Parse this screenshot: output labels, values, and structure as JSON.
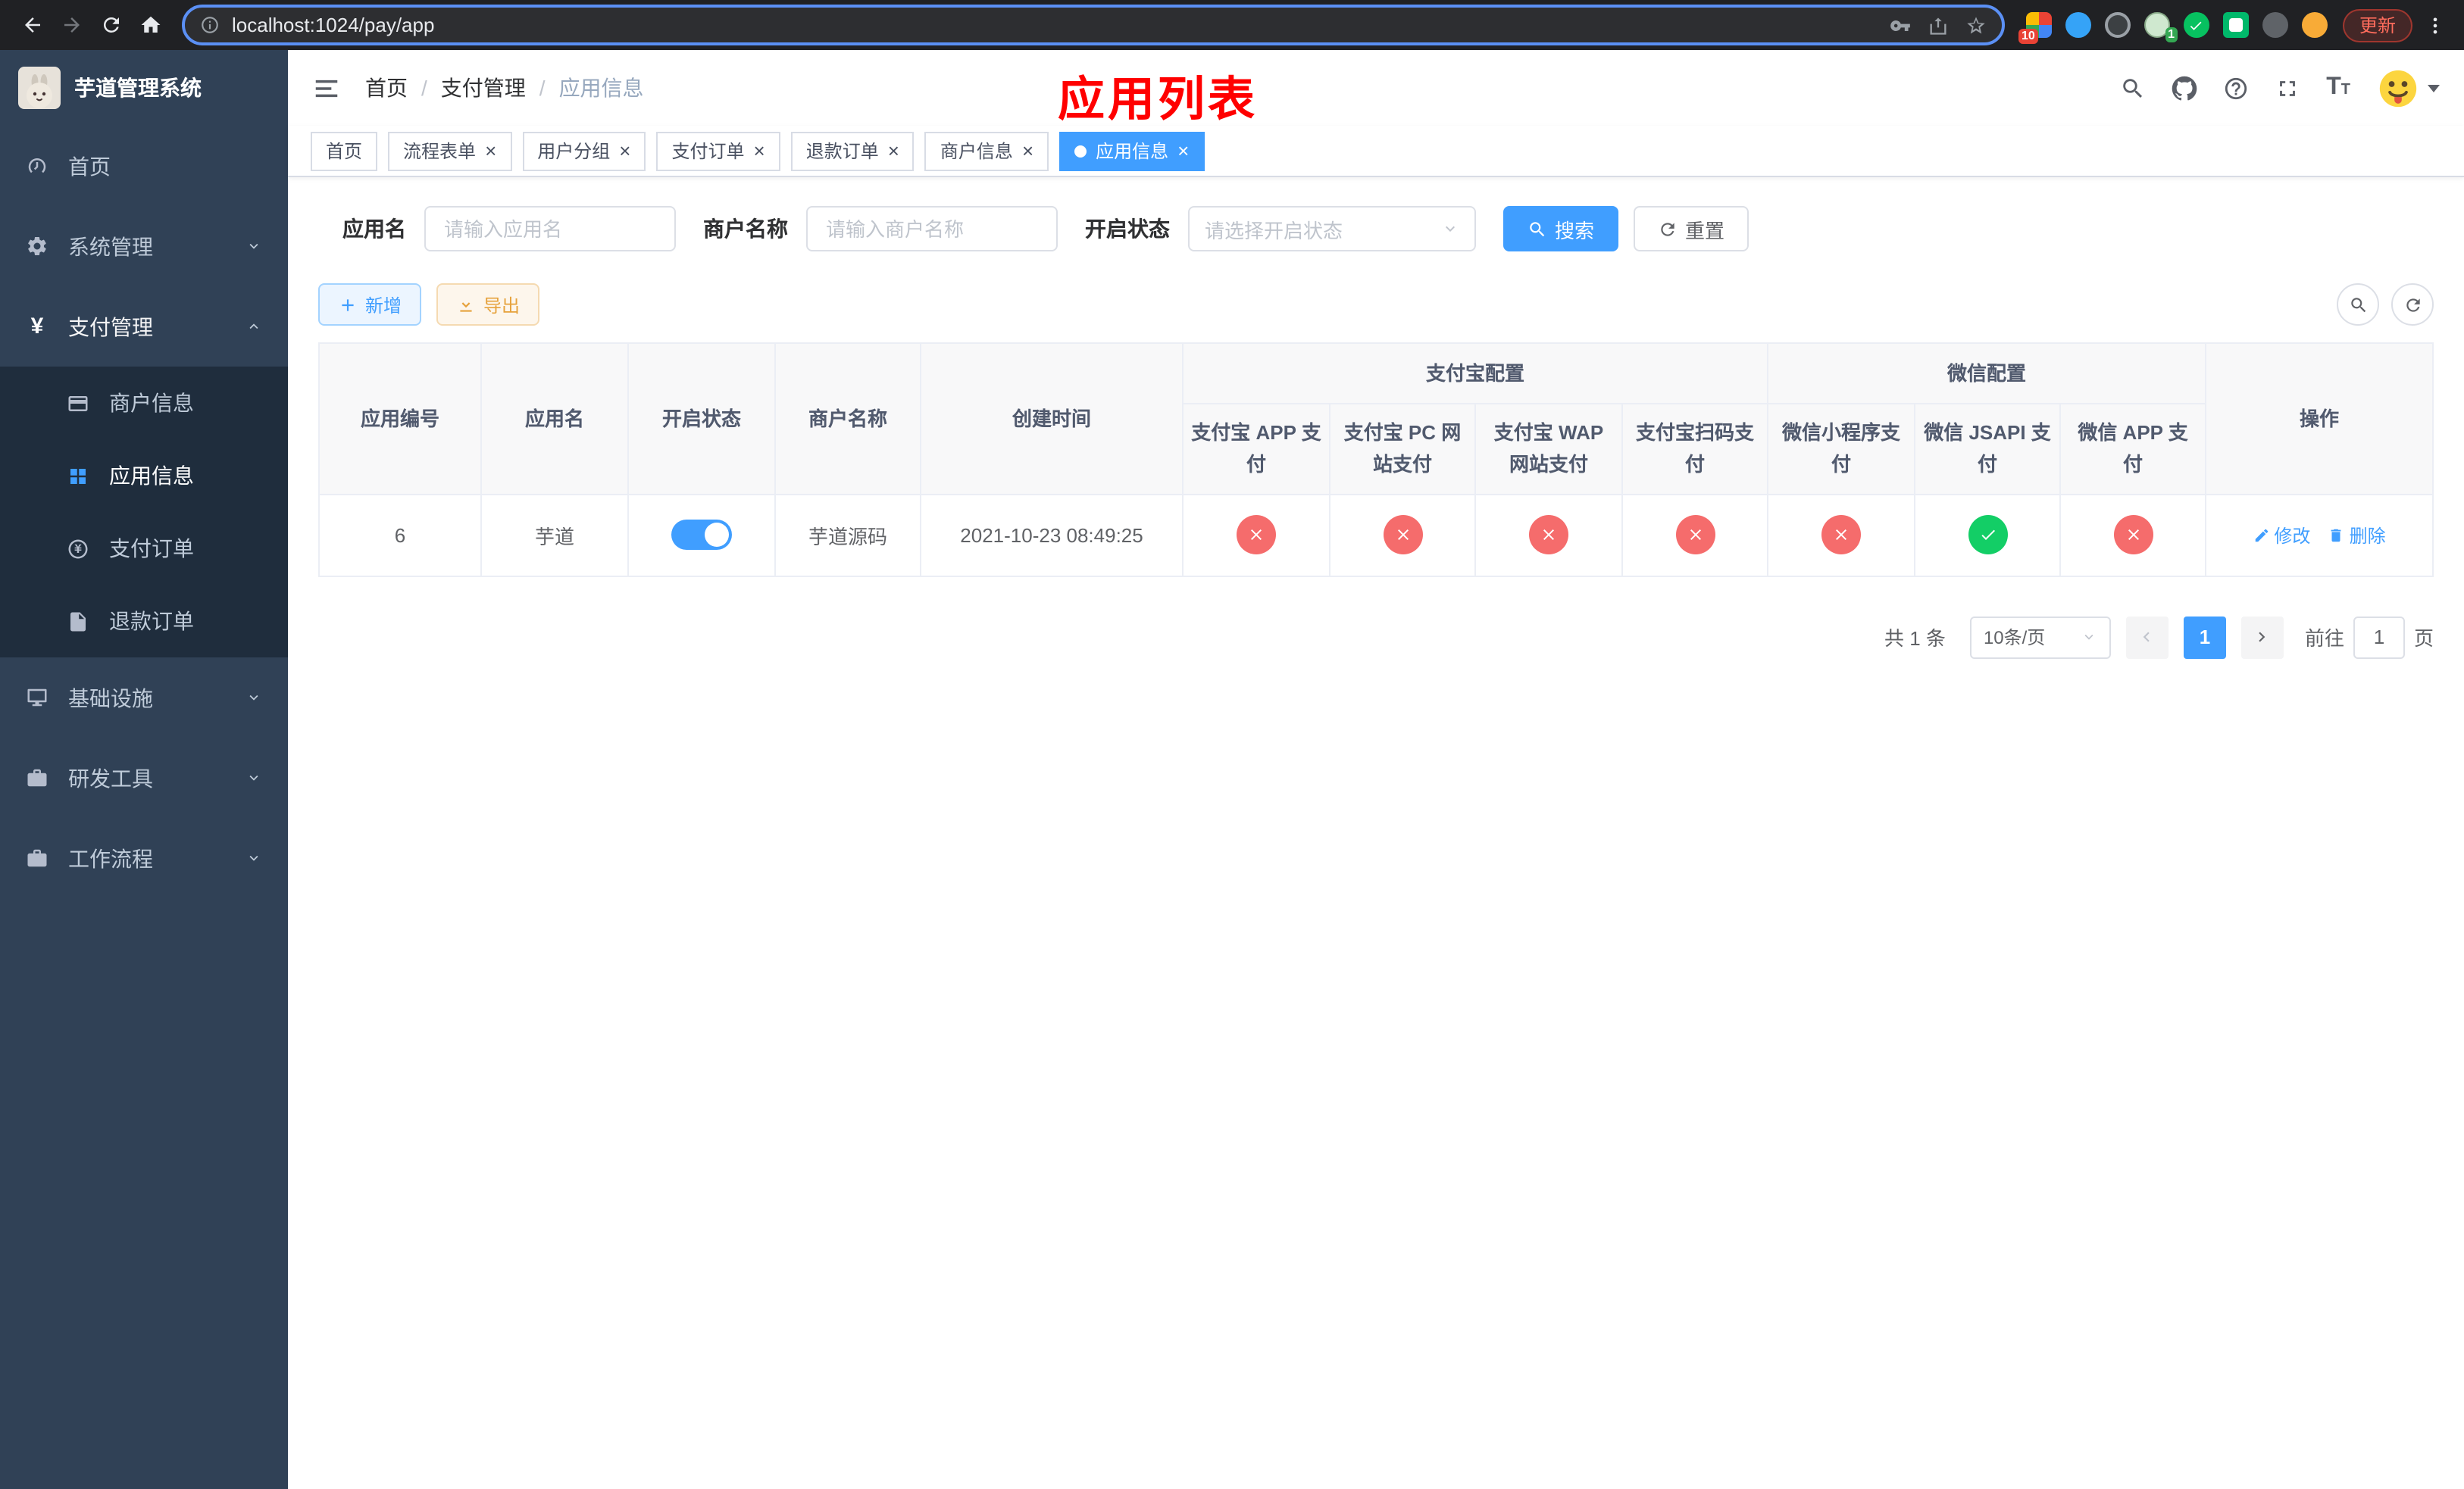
{
  "browser": {
    "url": "localhost:1024/pay/app",
    "update_label": "更新",
    "ext_badge_red": "10",
    "ext_badge_green": "1"
  },
  "sidebar": {
    "title": "芋道管理系统",
    "items": [
      {
        "label": "首页"
      },
      {
        "label": "系统管理"
      },
      {
        "label": "支付管理",
        "children": [
          {
            "label": "商户信息"
          },
          {
            "label": "应用信息"
          },
          {
            "label": "支付订单"
          },
          {
            "label": "退款订单"
          }
        ]
      },
      {
        "label": "基础设施"
      },
      {
        "label": "研发工具"
      },
      {
        "label": "工作流程"
      }
    ]
  },
  "header": {
    "breadcrumb": [
      "首页",
      "支付管理",
      "应用信息"
    ],
    "annotation": "应用列表"
  },
  "tabs": [
    {
      "label": "首页"
    },
    {
      "label": "流程表单"
    },
    {
      "label": "用户分组"
    },
    {
      "label": "支付订单"
    },
    {
      "label": "退款订单"
    },
    {
      "label": "商户信息"
    },
    {
      "label": "应用信息"
    }
  ],
  "filters": {
    "app_name_label": "应用名",
    "app_name_placeholder": "请输入应用名",
    "merchant_label": "商户名称",
    "merchant_placeholder": "请输入商户名称",
    "status_label": "开启状态",
    "status_placeholder": "请选择开启状态",
    "search_label": "搜索",
    "reset_label": "重置"
  },
  "toolbar": {
    "add_label": "新增",
    "export_label": "导出"
  },
  "table": {
    "groups": {
      "alipay": "支付宝配置",
      "wechat": "微信配置"
    },
    "headers": {
      "id": "应用编号",
      "name": "应用名",
      "status": "开启状态",
      "merchant": "商户名称",
      "created": "创建时间",
      "actions": "操作"
    },
    "pay_columns": [
      "支付宝 APP 支付",
      "支付宝 PC 网站支付",
      "支付宝 WAP 网站支付",
      "支付宝扫码支付",
      "微信小程序支付",
      "微信 JSAPI 支付",
      "微信 APP 支付"
    ],
    "rows": [
      {
        "id": "6",
        "name": "芋道",
        "status_on": true,
        "merchant": "芋道源码",
        "created": "2021-10-23 08:49:25",
        "configs": [
          "disabled",
          "disabled",
          "disabled",
          "disabled",
          "disabled",
          "enabled",
          "disabled"
        ],
        "edit_label": "修改",
        "delete_label": "删除"
      }
    ]
  },
  "pagination": {
    "total": "共 1 条",
    "page_size": "10条/页",
    "current_page": "1",
    "goto_label": "前往",
    "goto_value": "1",
    "goto_unit": "页"
  }
}
